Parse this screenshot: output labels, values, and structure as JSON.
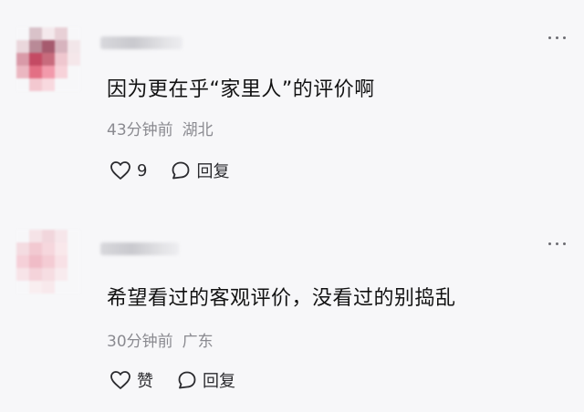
{
  "comments": [
    {
      "text": "因为更在乎“家里人”的评价啊",
      "time": "43分钟前",
      "region": "湖北",
      "like_label": "9",
      "reply_label": "回复",
      "avatar_colors": [
        "#f7f7f9",
        "#d9c2c9",
        "#f4e9ec",
        "#e8d0d6",
        "#f7f7f9",
        "#ead7dc",
        "#b98a97",
        "#a65a6e",
        "#d7b4be",
        "#f2e6e9",
        "#d99aa8",
        "#c44a63",
        "#c86b7d",
        "#efc7cf",
        "#f5e7ea",
        "#ebb7c1",
        "#e36f84",
        "#f29aab",
        "#f7d2d9",
        "#f7f7f9",
        "#f7f7f9",
        "#f3c8d0",
        "#f8d9df",
        "#f7f7f9",
        "#f7f7f9"
      ]
    },
    {
      "text": "希望看过的客观评价，没看过的别捣乱",
      "time": "30分钟前",
      "region": "广东",
      "like_label": "赞",
      "reply_label": "回复",
      "avatar_colors": [
        "#f7f7f9",
        "#f5e3e7",
        "#f1d6dc",
        "#f6e6ea",
        "#f7f7f9",
        "#f4dce1",
        "#f2c9d1",
        "#f6d7dd",
        "#f9e8eb",
        "#f7f7f9",
        "#f5d0d8",
        "#f0bcc7",
        "#f4ccd4",
        "#f8e1e6",
        "#f7f7f9",
        "#f7e4e8",
        "#f4d3da",
        "#f6dde2",
        "#f8ebee",
        "#f7f7f9",
        "#f7f7f9",
        "#f9eef0",
        "#f8e9ec",
        "#f7f7f9",
        "#f7f7f9"
      ]
    }
  ],
  "colors": {
    "text": "#121212",
    "meta": "#8a8a90",
    "icon": "#2a2a2e",
    "background": "#f7f7f9"
  },
  "icons": {
    "more": "more-dots-icon",
    "like": "heart-icon",
    "reply": "comment-bubble-icon"
  }
}
